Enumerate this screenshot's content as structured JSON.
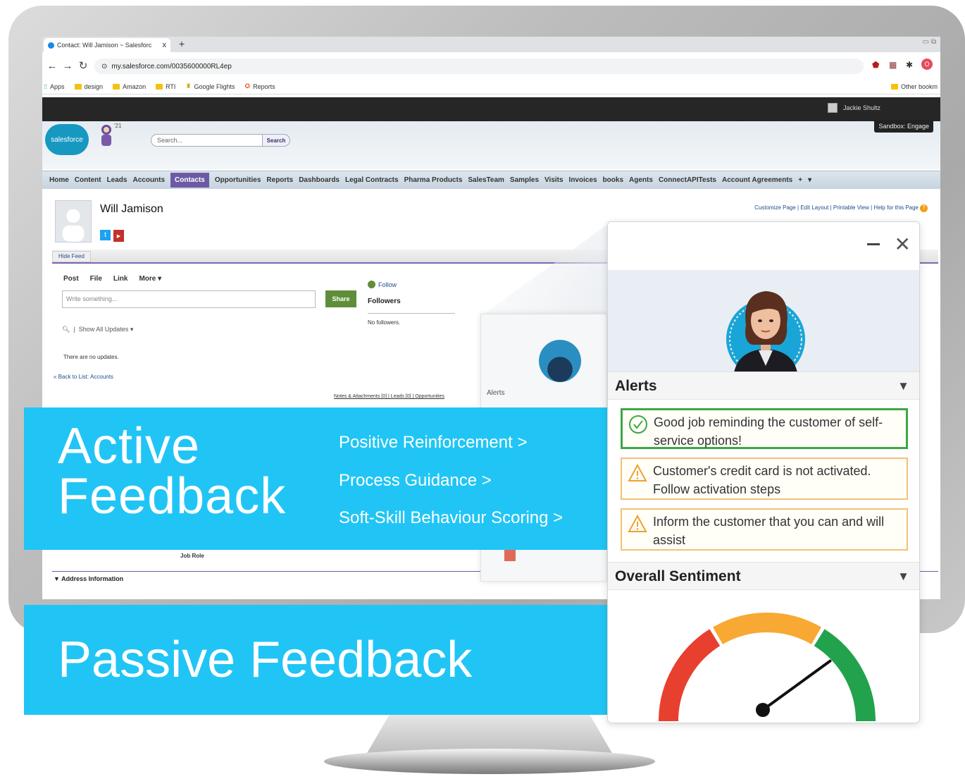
{
  "browser": {
    "tab_title": "Contact: Will Jamison ~ Salesforc",
    "tab_close": "x",
    "new_tab": "+",
    "url": "my.salesforce.com/0035600000RL4ep",
    "bookmarks": [
      "Apps",
      "design",
      "Amazon",
      "RTI",
      "Google Flights",
      "Reports"
    ],
    "other_bookmarks": "Other bookm"
  },
  "salesforce": {
    "user_name": "Jackie Shultz",
    "sandbox_label": "Sandbox:  Engage",
    "logo_text": "salesforce",
    "release_badge": "'21",
    "search_placeholder": "Search...",
    "search_button": "Search",
    "nav_tabs": [
      "Home",
      "Content",
      "Leads",
      "Accounts",
      "Contacts",
      "Opportunities",
      "Reports",
      "Dashboards",
      "Legal Contracts",
      "Pharma Products",
      "SalesTeam",
      "Samples",
      "Visits",
      "Invoices",
      "books",
      "Agents",
      "ConnectAPITests",
      "Account Agreements",
      "+",
      "▾"
    ],
    "active_tab": "Contacts",
    "contact_name": "Will Jamison",
    "page_links": "Customize Page | Edit Layout | Printable View | Help for this Page",
    "hide_feed": "Hide Feed",
    "feed_tools": [
      "Post",
      "File",
      "Link",
      "More ▾"
    ],
    "write_placeholder": "Write something...",
    "share_button": "Share",
    "follow_label": "Follow",
    "followers_label": "Followers",
    "no_followers": "No followers.",
    "show_updates": "Show All Updates",
    "no_updates": "There are no updates.",
    "back_to_list": "« Back to List: Accounts",
    "related_links": "Notes & Attachments [0]  |  Leads [0]  |  Opportunities",
    "job_role": "Job Role",
    "address_info": "▼ Address Information"
  },
  "mini_widget": {
    "alerts_label": "Alerts"
  },
  "active_feedback": {
    "title_line1": "Active",
    "title_line2": "Feedback",
    "links": [
      "Positive Reinforcement >",
      "Process Guidance >",
      "Soft-Skill Behaviour Scoring >"
    ]
  },
  "passive_feedback": {
    "title": "Passive Feedback"
  },
  "assistant_panel": {
    "alerts_heading": "Alerts",
    "alerts": [
      {
        "text": "Good job reminding the customer of self-service options!",
        "type": "positive"
      },
      {
        "text": "Customer's credit card is not activated. Follow activation steps",
        "type": "warning"
      },
      {
        "text": "Inform the customer that you can and will assist",
        "type": "warning"
      }
    ],
    "sentiment_heading": "Overall Sentiment",
    "sentiment_level": 0.8,
    "colors": {
      "accent": "#21c5f5",
      "positive": "#3ca845",
      "warning": "#f0c27b",
      "gauge_red": "#e8402f",
      "gauge_orange": "#f7a934",
      "gauge_green": "#23a24d"
    }
  }
}
